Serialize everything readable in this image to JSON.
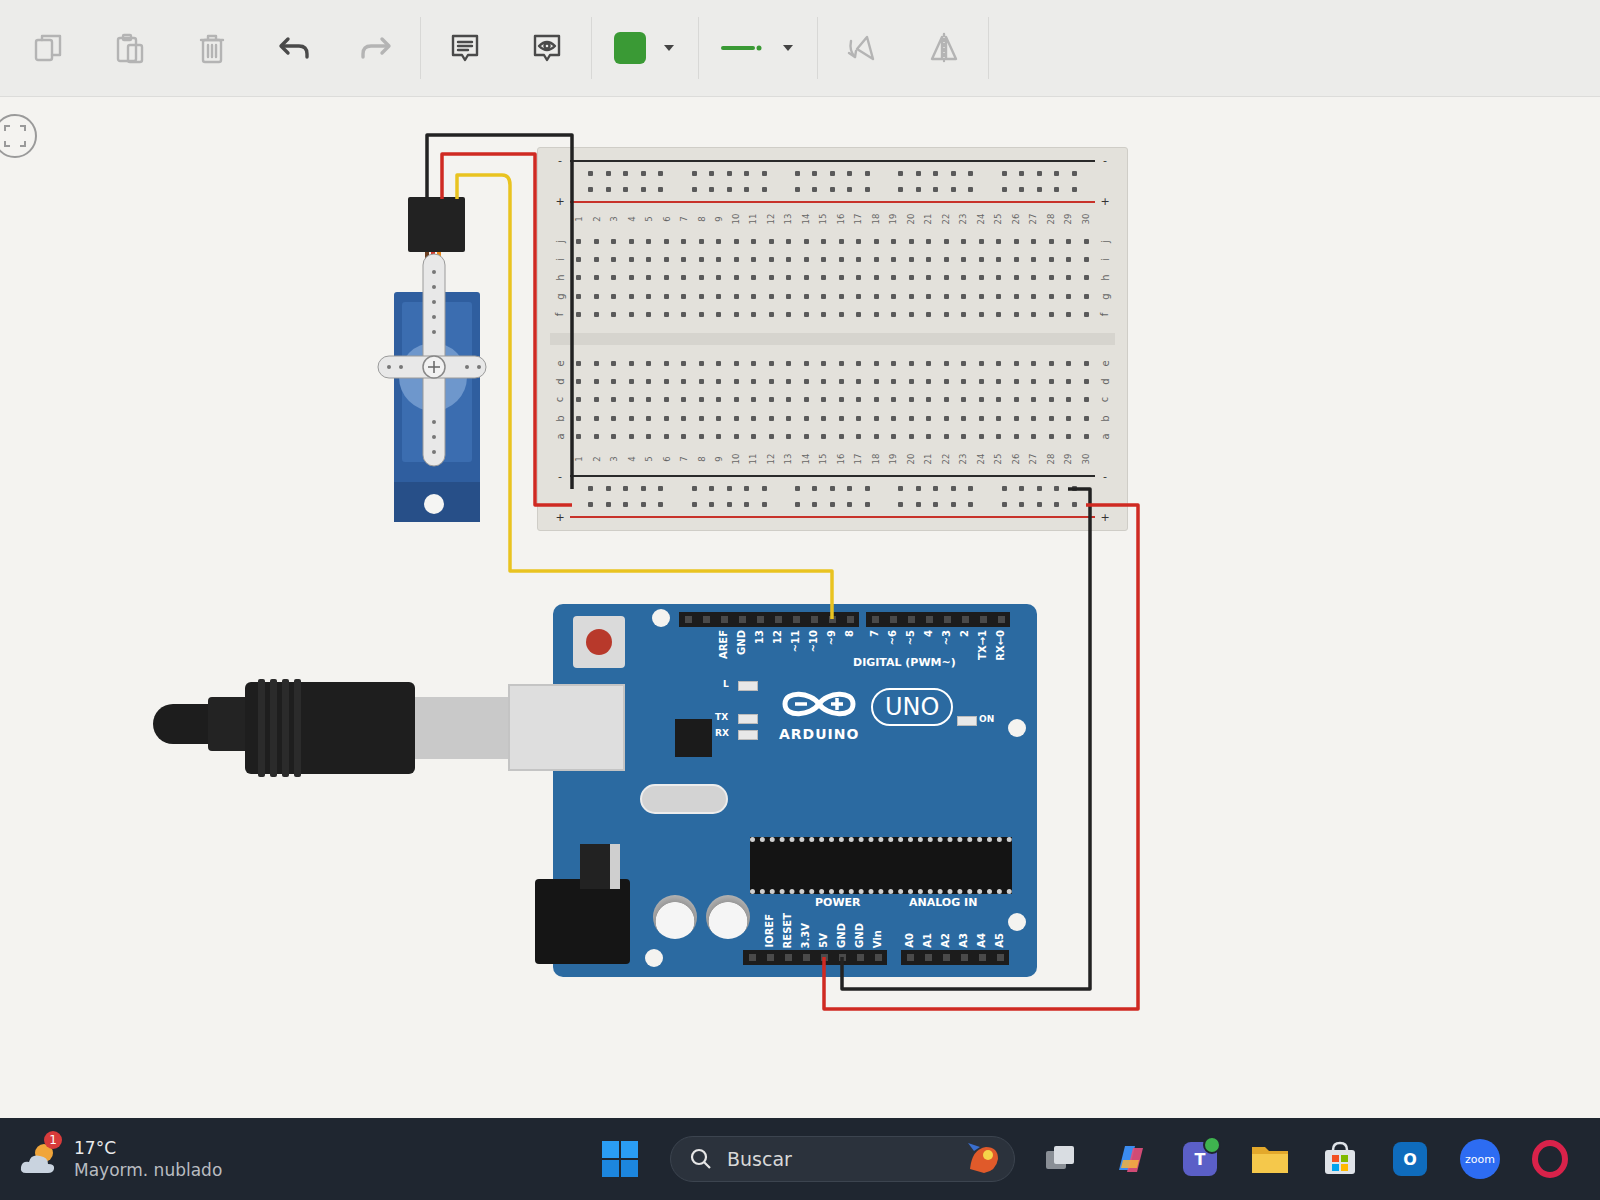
{
  "toolbar": {
    "buttons": [
      {
        "kind": "copy",
        "disabled": true
      },
      {
        "kind": "paste",
        "disabled": true
      },
      {
        "kind": "delete",
        "disabled": true
      },
      {
        "kind": "undo",
        "disabled": false
      },
      {
        "kind": "redo",
        "disabled": true
      },
      {
        "kind": "note",
        "disabled": false
      },
      {
        "kind": "notes-visibility",
        "disabled": false
      }
    ],
    "color_picker": {
      "color": "#3a9a35"
    },
    "transform_buttons": [
      {
        "kind": "rotate",
        "disabled": true
      },
      {
        "kind": "mirror",
        "disabled": true
      }
    ]
  },
  "breadboard": {
    "rails": [
      {
        "sign": "-",
        "color": "#2a2a2a"
      },
      {
        "sign": "+",
        "color": "#c8322a"
      }
    ],
    "columns": [
      "1",
      "2",
      "3",
      "4",
      "5",
      "6",
      "7",
      "8",
      "9",
      "10",
      "11",
      "12",
      "13",
      "14",
      "15",
      "16",
      "17",
      "18",
      "19",
      "20",
      "21",
      "22",
      "23",
      "24",
      "25",
      "26",
      "27",
      "28",
      "29",
      "30"
    ],
    "rows_top": [
      "j",
      "i",
      "h",
      "g",
      "f"
    ],
    "rows_bottom": [
      "e",
      "d",
      "c",
      "b",
      "a"
    ]
  },
  "wires": [
    {
      "color": "#222222"
    },
    {
      "color": "#cf2a22"
    },
    {
      "color": "#e9c320"
    },
    {
      "color": "#222222"
    },
    {
      "color": "#cf2a22"
    }
  ],
  "arduino": {
    "digital_left": [
      "AREF",
      "GND",
      "13",
      "12",
      "~11",
      "~10",
      "~9",
      "8"
    ],
    "digital_right": [
      "7",
      "~6",
      "~5",
      "4",
      "~3",
      "2",
      "TX→1",
      "RX←0"
    ],
    "digital_title": "DIGITAL (PWM~)",
    "led_l": "L",
    "led_tx": "TX",
    "led_rx": "RX",
    "brand": "ARDUINO",
    "model": "UNO",
    "on_label": "ON",
    "power_pins": [
      "IOREF",
      "RESET",
      "3.3V",
      "5V",
      "GND",
      "GND",
      "Vin"
    ],
    "power_title": "POWER",
    "analog_title": "ANALOG IN",
    "analog_pins": [
      "A0",
      "A1",
      "A2",
      "A3",
      "A4",
      "A5"
    ]
  },
  "taskbar": {
    "weather": {
      "temperature": "17°C",
      "condition": "Mayorm. nublado",
      "badge": "1"
    },
    "search": {
      "placeholder": "Buscar"
    },
    "apps": [
      {
        "kind": "task-view"
      },
      {
        "kind": "copilot"
      },
      {
        "kind": "teams",
        "glyph": "T"
      },
      {
        "kind": "explorer"
      },
      {
        "kind": "store"
      },
      {
        "kind": "outlook",
        "glyph": "O"
      },
      {
        "kind": "zoom",
        "glyph": "zoom"
      },
      {
        "kind": "opera"
      }
    ]
  }
}
